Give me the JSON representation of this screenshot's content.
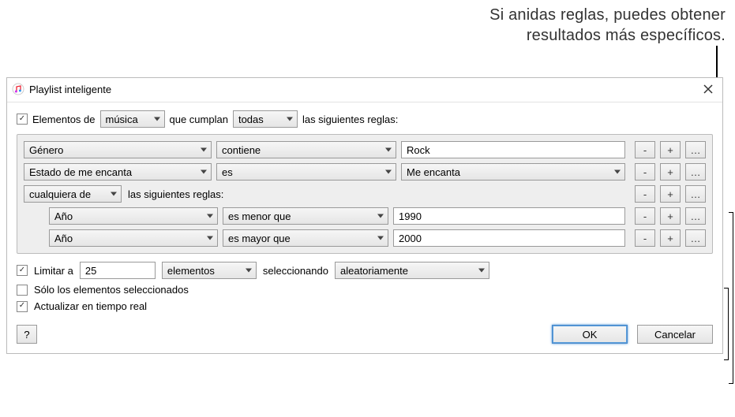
{
  "tooltip": {
    "line1": "Si anidas reglas, puedes obtener",
    "line2": "resultados más específicos."
  },
  "titlebar": {
    "title": "Playlist inteligente"
  },
  "match": {
    "elements_label": "Elementos de",
    "source": "música",
    "meet_label": "que cumplan",
    "mode": "todas",
    "tail": "las siguientes reglas:"
  },
  "rules": [
    {
      "field": "Género",
      "op": "contiene",
      "value": "Rock",
      "valueType": "text"
    },
    {
      "field": "Estado de me encanta",
      "op": "es",
      "value": "Me encanta",
      "valueType": "select"
    }
  ],
  "nested": {
    "mode": "cualquiera de",
    "tail": "las siguientes reglas:",
    "rules": [
      {
        "field": "Año",
        "op": "es menor que",
        "value": "1990"
      },
      {
        "field": "Año",
        "op": "es mayor que",
        "value": "2000"
      }
    ]
  },
  "buttons": {
    "minus": "-",
    "plus": "+",
    "more": "…"
  },
  "limit": {
    "label": "Limitar a",
    "value": "25",
    "unit": "elementos",
    "selecting_label": "seleccionando",
    "method": "aleatoriamente"
  },
  "options": {
    "checked_only": "Sólo los elementos seleccionados",
    "live_update": "Actualizar en tiempo real"
  },
  "footer": {
    "help": "?",
    "ok": "OK",
    "cancel": "Cancelar"
  }
}
